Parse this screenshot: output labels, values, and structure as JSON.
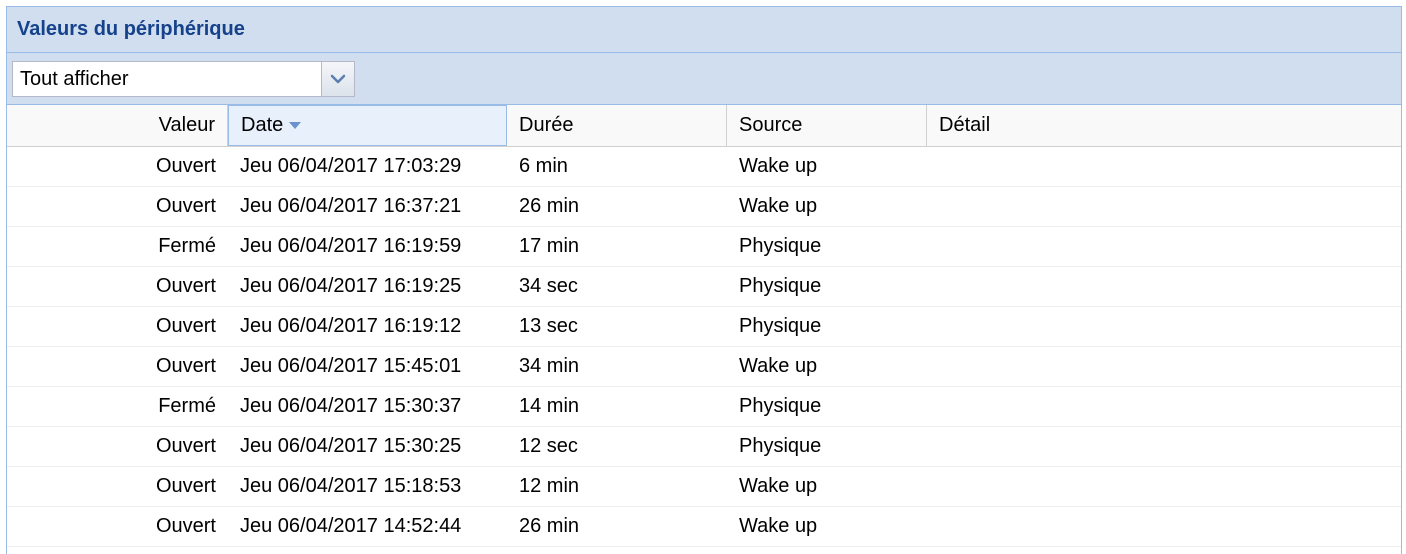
{
  "panel": {
    "title": "Valeurs du périphérique"
  },
  "filter": {
    "value": "Tout afficher",
    "trigger_icon": "chevron-down-icon"
  },
  "columns": [
    {
      "key": "valeur",
      "label": "Valeur"
    },
    {
      "key": "date",
      "label": "Date",
      "sorted": "desc"
    },
    {
      "key": "duree",
      "label": "Durée"
    },
    {
      "key": "source",
      "label": "Source"
    },
    {
      "key": "detail",
      "label": "Détail"
    }
  ],
  "rows": [
    {
      "valeur": "Ouvert",
      "date": "Jeu 06/04/2017 17:03:29",
      "duree": "6 min",
      "source": "Wake up",
      "detail": ""
    },
    {
      "valeur": "Ouvert",
      "date": "Jeu 06/04/2017 16:37:21",
      "duree": "26 min",
      "source": "Wake up",
      "detail": ""
    },
    {
      "valeur": "Fermé",
      "date": "Jeu 06/04/2017 16:19:59",
      "duree": "17 min",
      "source": "Physique",
      "detail": ""
    },
    {
      "valeur": "Ouvert",
      "date": "Jeu 06/04/2017 16:19:25",
      "duree": "34 sec",
      "source": "Physique",
      "detail": ""
    },
    {
      "valeur": "Ouvert",
      "date": "Jeu 06/04/2017 16:19:12",
      "duree": "13 sec",
      "source": "Physique",
      "detail": ""
    },
    {
      "valeur": "Ouvert",
      "date": "Jeu 06/04/2017 15:45:01",
      "duree": "34 min",
      "source": "Wake up",
      "detail": ""
    },
    {
      "valeur": "Fermé",
      "date": "Jeu 06/04/2017 15:30:37",
      "duree": "14 min",
      "source": "Physique",
      "detail": ""
    },
    {
      "valeur": "Ouvert",
      "date": "Jeu 06/04/2017 15:30:25",
      "duree": "12 sec",
      "source": "Physique",
      "detail": ""
    },
    {
      "valeur": "Ouvert",
      "date": "Jeu 06/04/2017 15:18:53",
      "duree": "12 min",
      "source": "Wake up",
      "detail": ""
    },
    {
      "valeur": "Ouvert",
      "date": "Jeu 06/04/2017 14:52:44",
      "duree": "26 min",
      "source": "Wake up",
      "detail": ""
    }
  ],
  "colors": {
    "header_bg": "#d0def0",
    "title": "#15428b",
    "border": "#99bbe8"
  }
}
